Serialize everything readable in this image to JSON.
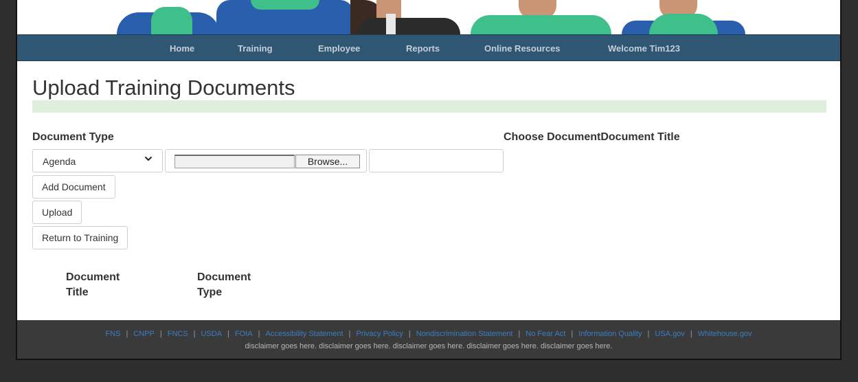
{
  "nav": {
    "items": [
      {
        "label": "Home"
      },
      {
        "label": "Training"
      },
      {
        "label": "Employee"
      },
      {
        "label": "Reports"
      },
      {
        "label": "Online Resources"
      },
      {
        "label": "Welcome Tim123"
      }
    ]
  },
  "page": {
    "title": "Upload Training Documents"
  },
  "form": {
    "document_type_label": "Document Type",
    "choose_document_label": "Choose Document",
    "document_title_label": "Document Title",
    "document_type_value": "Agenda",
    "browse_label": "Browse...",
    "add_document_label": "Add Document",
    "upload_label": "Upload",
    "return_label": "Return to Training"
  },
  "table": {
    "columns": [
      {
        "label": "Document Title"
      },
      {
        "label": "Document Type"
      }
    ]
  },
  "footer": {
    "links": [
      {
        "label": "FNS"
      },
      {
        "label": "CNPP"
      },
      {
        "label": "FNCS"
      },
      {
        "label": "USDA"
      },
      {
        "label": "FOIA"
      },
      {
        "label": "Accessibility Statement"
      },
      {
        "label": "Privacy Policy"
      },
      {
        "label": "Nondiscrimination Statement"
      },
      {
        "label": "No Fear Act"
      },
      {
        "label": "Information Quality"
      },
      {
        "label": "USA.gov"
      },
      {
        "label": "Whitehouse.gov"
      }
    ],
    "separator": "|",
    "disclaimer": "disclaimer goes here. disclaimer goes here. disclaimer goes here. disclaimer goes here. disclaimer goes here."
  },
  "colors": {
    "navbar": "#2f5673",
    "title_rule": "#dfeedd",
    "footer": "#3a3a3a",
    "footer_link": "#3a7fc4"
  },
  "icons": {
    "select_chevron": "chevron-down-icon"
  }
}
